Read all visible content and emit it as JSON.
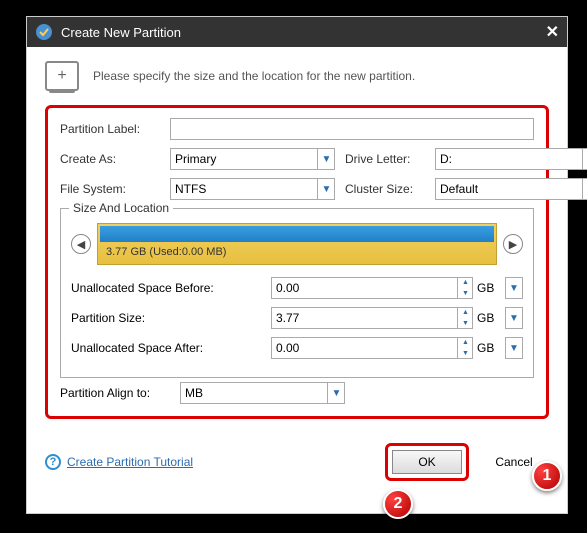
{
  "title": "Create New Partition",
  "intro": "Please specify the size and the location for the new partition.",
  "labels": {
    "partition_label": "Partition Label:",
    "create_as": "Create As:",
    "drive_letter": "Drive Letter:",
    "file_system": "File System:",
    "cluster_size": "Cluster Size:",
    "size_location": "Size And Location",
    "unalloc_before": "Unallocated Space Before:",
    "partition_size": "Partition Size:",
    "unalloc_after": "Unallocated Space After:",
    "align_to": "Partition Align to:",
    "tutorial": "Create Partition Tutorial",
    "ok": "OK",
    "cancel": "Cancel"
  },
  "values": {
    "partition_label": "",
    "create_as": "Primary",
    "drive_letter": "D:",
    "file_system": "NTFS",
    "cluster_size": "Default",
    "bar_label": "3.77 GB (Used:0.00 MB)",
    "unalloc_before": "0.00",
    "partition_size": "3.77",
    "unalloc_after": "0.00",
    "align_to": "MB",
    "unit": "GB"
  },
  "badges": {
    "b1": "1",
    "b2": "2"
  }
}
